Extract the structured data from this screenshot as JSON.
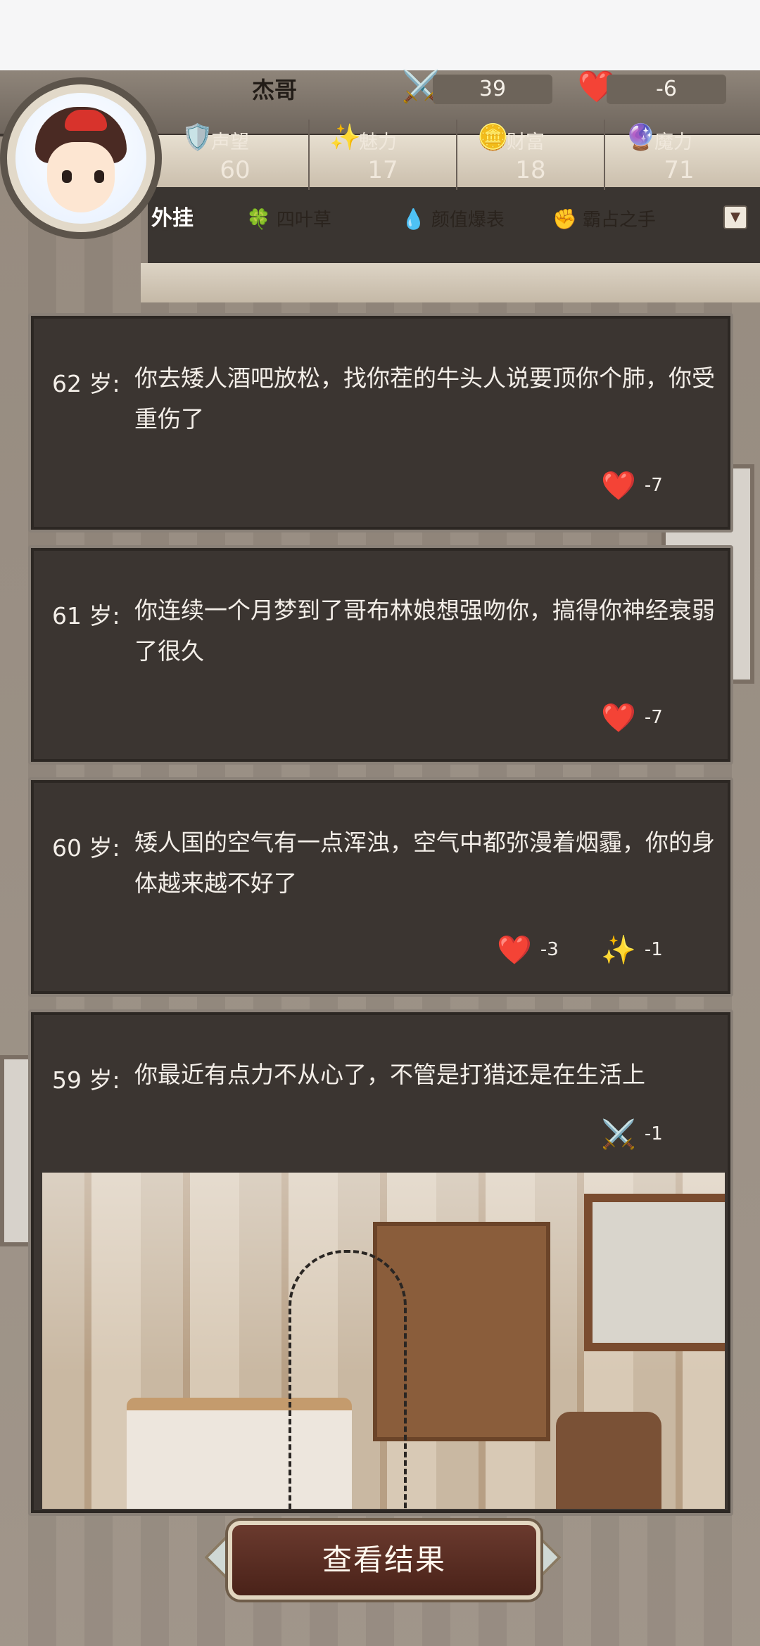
{
  "header": {
    "player_name": "杰哥",
    "attack_icon": "sword-icon",
    "attack_value": "39",
    "health_icon": "heart-icon",
    "health_value": "-6",
    "stats": [
      {
        "label": "声望",
        "icon": "shield-icon",
        "value": "60"
      },
      {
        "label": "魅力",
        "icon": "sparkle-icon",
        "value": "17"
      },
      {
        "label": "财富",
        "icon": "coins-icon",
        "value": "18"
      },
      {
        "label": "魔力",
        "icon": "magic-orb-icon",
        "value": "71"
      }
    ],
    "cheat_label": "外挂",
    "cheats": [
      {
        "label": "四叶草",
        "icon": "clover-icon"
      },
      {
        "label": "颜值爆表",
        "icon": "bubble-icon"
      },
      {
        "label": "霸占之手",
        "icon": "fist-icon"
      }
    ]
  },
  "events": [
    {
      "age": "62 岁:",
      "text": "你去矮人酒吧放松，找你茬的牛头人说要顶你个肺，你受重伤了",
      "effects": [
        {
          "icon": "heart-icon",
          "value": "-7"
        }
      ]
    },
    {
      "age": "61 岁:",
      "text": "你连续一个月梦到了哥布林娘想强吻你，搞得你神经衰弱了很久",
      "effects": [
        {
          "icon": "heart-icon",
          "value": "-7"
        }
      ]
    },
    {
      "age": "60 岁:",
      "text": "矮人国的空气有一点浑浊，空气中都弥漫着烟霾，你的身体越来越不好了",
      "effects": [
        {
          "icon": "heart-icon",
          "value": "-3"
        },
        {
          "icon": "sparkle-icon",
          "value": "-1"
        }
      ]
    },
    {
      "age": "59 岁:",
      "text": "你最近有点力不从心了，不管是打猎还是在生活上",
      "effects": [
        {
          "icon": "sword-icon",
          "value": "-1"
        }
      ]
    }
  ],
  "result_button": "查看结果"
}
